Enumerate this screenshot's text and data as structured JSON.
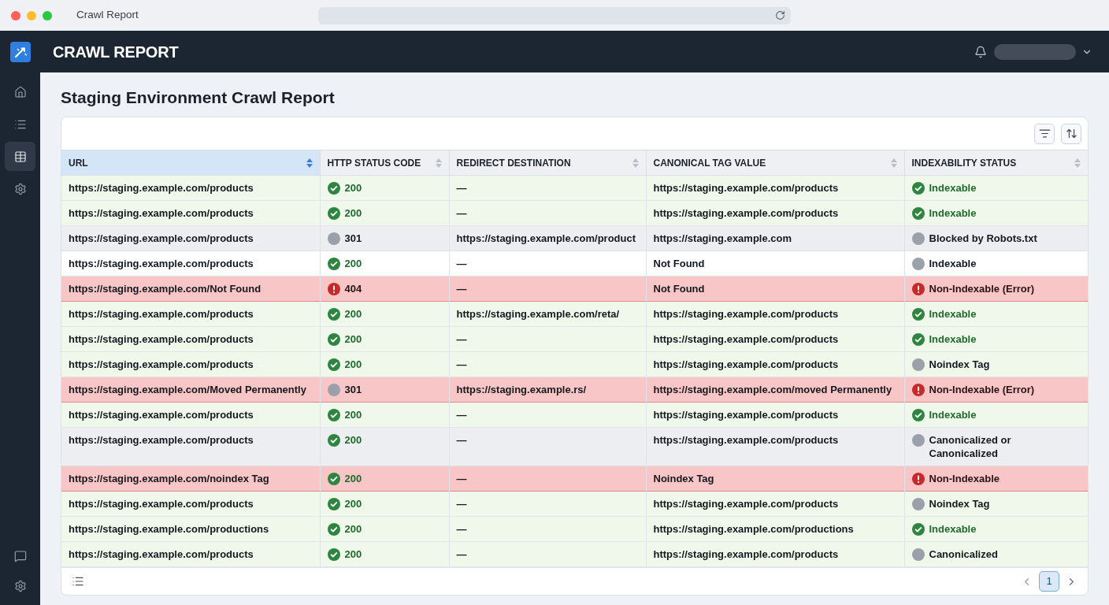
{
  "window": {
    "title": "Crawl Report"
  },
  "app_header": {
    "title": "CRAWL REPORT"
  },
  "sidebar": {
    "items": [
      {
        "selected": false
      },
      {
        "selected": false
      },
      {
        "selected": true
      },
      {
        "selected": false
      }
    ]
  },
  "page": {
    "title": "Staging Environment Crawl Report"
  },
  "table": {
    "columns": [
      {
        "label": "URL",
        "selected": true
      },
      {
        "label": "HTTP STATUS CODE",
        "selected": false
      },
      {
        "label": "REDIRECT DESTINATION",
        "selected": false
      },
      {
        "label": "CANONICAL TAG VALUE",
        "selected": false
      },
      {
        "label": "INDEXABILITY STATUS",
        "selected": false
      }
    ],
    "rows": [
      {
        "kind": "success",
        "url": "https://staging.example.com/products",
        "status": {
          "code": "200",
          "kind": "ok"
        },
        "redirect": "—",
        "canonical": "https://staging.example.com/products",
        "indexability": {
          "label": "Indexable",
          "kind": "ok"
        }
      },
      {
        "kind": "success",
        "url": "https://staging.example.com/products",
        "status": {
          "code": "200",
          "kind": "ok"
        },
        "redirect": "—",
        "canonical": "https://staging.example.com/products",
        "indexability": {
          "label": "Indexable",
          "kind": "ok"
        }
      },
      {
        "kind": "neutral",
        "url": "https://staging.example.com/products",
        "status": {
          "code": "301",
          "kind": "neutral"
        },
        "redirect": "https://staging.example.com/product",
        "canonical": "https://staging.example.com",
        "indexability": {
          "label": "Blocked by Robots.txt",
          "kind": "neutral"
        }
      },
      {
        "kind": "plain",
        "url": "https://staging.example.com/products",
        "status": {
          "code": "200",
          "kind": "ok"
        },
        "redirect": "—",
        "canonical": "Not Found",
        "indexability": {
          "label": "Indexable",
          "kind": "neutral"
        }
      },
      {
        "kind": "error",
        "url": "https://staging.example.com/Not Found",
        "status": {
          "code": "404",
          "kind": "error"
        },
        "redirect": "—",
        "canonical": "Not Found",
        "indexability": {
          "label": "Non-Indexable (Error)",
          "kind": "error"
        }
      },
      {
        "kind": "success",
        "url": "https://staging.example.com/products",
        "status": {
          "code": "200",
          "kind": "ok"
        },
        "redirect": "https://staging.example.com/reta/",
        "canonical": "https://staging.example.com/products",
        "indexability": {
          "label": "Indexable",
          "kind": "ok"
        }
      },
      {
        "kind": "success",
        "url": "https://staging.example.com/products",
        "status": {
          "code": "200",
          "kind": "ok"
        },
        "redirect": "—",
        "canonical": "https://staging.example.com/products",
        "indexability": {
          "label": "Indexable",
          "kind": "ok"
        }
      },
      {
        "kind": "success",
        "url": "https://staging.example.com/products",
        "status": {
          "code": "200",
          "kind": "ok"
        },
        "redirect": "—",
        "canonical": "https://staging.example.com/products",
        "indexability": {
          "label": "Noindex Tag",
          "kind": "neutral"
        }
      },
      {
        "kind": "error",
        "url": "https://staging.example.com/Moved Permanently",
        "status": {
          "code": "301",
          "kind": "neutral"
        },
        "redirect": "https://staging.example.rs/",
        "canonical": "https://staging.example.com/moved Permanently",
        "indexability": {
          "label": "Non-Indexable (Error)",
          "kind": "error"
        }
      },
      {
        "kind": "success",
        "url": "https://staging.example.com/products",
        "status": {
          "code": "200",
          "kind": "ok"
        },
        "redirect": "—",
        "canonical": "https://staging.example.com/products",
        "indexability": {
          "label": "Indexable",
          "kind": "ok"
        }
      },
      {
        "kind": "neutral",
        "url": "https://staging.example.com/products",
        "status": {
          "code": "200",
          "kind": "ok"
        },
        "redirect": "—",
        "canonical": "https://staging.example.com/products",
        "indexability": {
          "label": "Canonicalized or Canonicalized",
          "kind": "neutral"
        }
      },
      {
        "kind": "error",
        "url": "https://staging.example.com/noindex Tag",
        "status": {
          "code": "200",
          "kind": "ok"
        },
        "redirect": "—",
        "canonical": "Noindex Tag",
        "indexability": {
          "label": "Non-Indexable",
          "kind": "error"
        }
      },
      {
        "kind": "success",
        "url": "https://staging.example.com/products",
        "status": {
          "code": "200",
          "kind": "ok"
        },
        "redirect": "—",
        "canonical": "https://staging.example.com/products",
        "indexability": {
          "label": "Noindex Tag",
          "kind": "neutral"
        }
      },
      {
        "kind": "success",
        "url": "https://staging.example.com/productions",
        "status": {
          "code": "200",
          "kind": "ok"
        },
        "redirect": "—",
        "canonical": "https://staging.example.com/productions",
        "indexability": {
          "label": "Indexable",
          "kind": "ok"
        }
      },
      {
        "kind": "success",
        "url": "https://staging.example.com/products",
        "status": {
          "code": "200",
          "kind": "ok"
        },
        "redirect": "—",
        "canonical": "https://staging.example.com/products",
        "indexability": {
          "label": "Canonicalized",
          "kind": "neutral"
        }
      }
    ]
  },
  "pagination": {
    "pages": [
      {
        "label": "1",
        "selected": true
      }
    ]
  }
}
